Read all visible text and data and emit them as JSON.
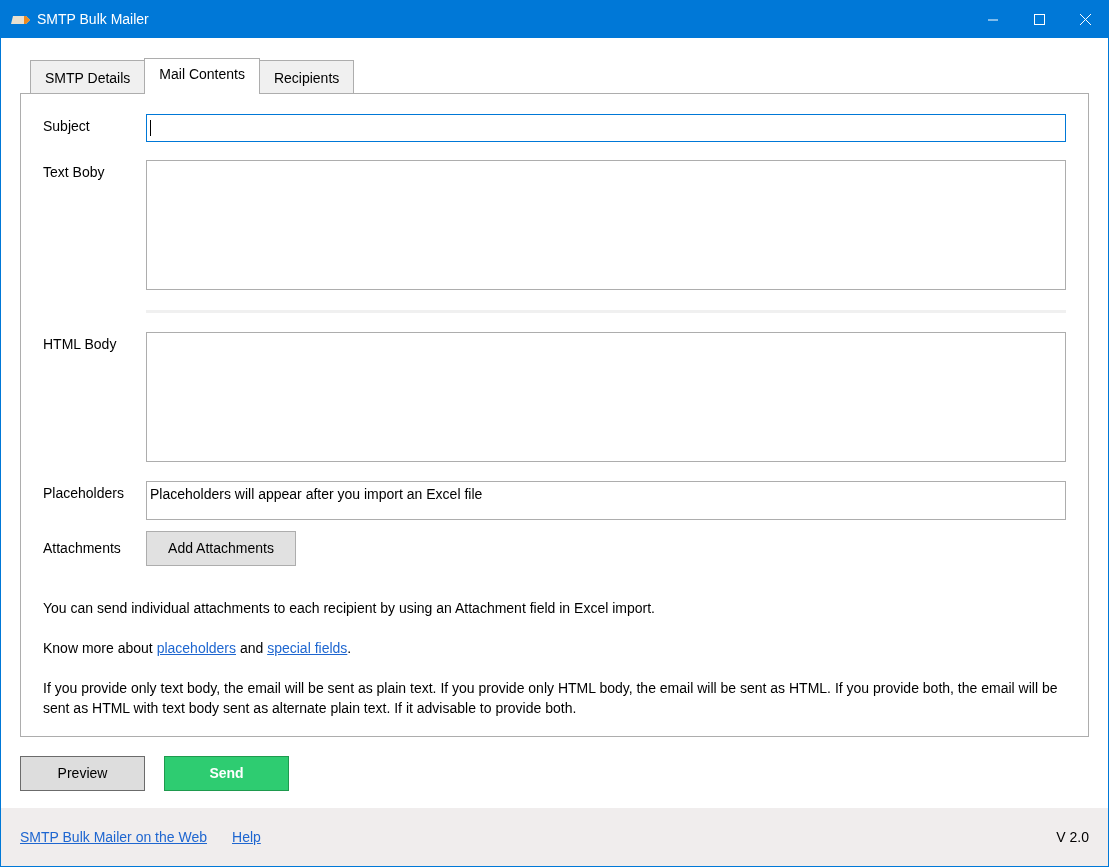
{
  "window": {
    "title": "SMTP Bulk Mailer"
  },
  "tabs": [
    {
      "label": "SMTP Details",
      "selected": false
    },
    {
      "label": "Mail Contents",
      "selected": true
    },
    {
      "label": "Recipients",
      "selected": false
    }
  ],
  "fields": [
    {
      "kind": "input",
      "label": "Subject",
      "focused": true
    },
    {
      "kind": "textarea",
      "label": "Text Boby",
      "focused": false
    },
    {
      "kind": "separator"
    },
    {
      "kind": "textarea",
      "label": "HTML Body",
      "focused": false
    },
    {
      "kind": "display",
      "label": "Placeholders",
      "value": "Placeholders will appear after you import an Excel file"
    },
    {
      "kind": "button",
      "label": "Attachments",
      "button": "Add Attachments"
    }
  ],
  "notes": [
    [
      {
        "text": "You can send individual attachments to each recipient by using an Attachment field in Excel import."
      }
    ],
    [
      {
        "text": "Know more about "
      },
      {
        "text": "placeholders",
        "link": true
      },
      {
        "text": " and "
      },
      {
        "text": "special fields",
        "link": true
      },
      {
        "text": "."
      }
    ],
    [
      {
        "text": "If you provide only text body, the email will be sent as plain text. If you provide only HTML body, the email will be sent as HTML. If you provide both, the email will be sent as HTML with text body sent as alternate plain text. If it advisable to provide both."
      }
    ]
  ],
  "actions": [
    {
      "label": "Preview",
      "kind": "secondary"
    },
    {
      "label": "Send",
      "kind": "primary"
    }
  ],
  "footer": {
    "links": [
      "SMTP Bulk Mailer on the Web",
      "Help"
    ],
    "version": "V 2.0"
  }
}
